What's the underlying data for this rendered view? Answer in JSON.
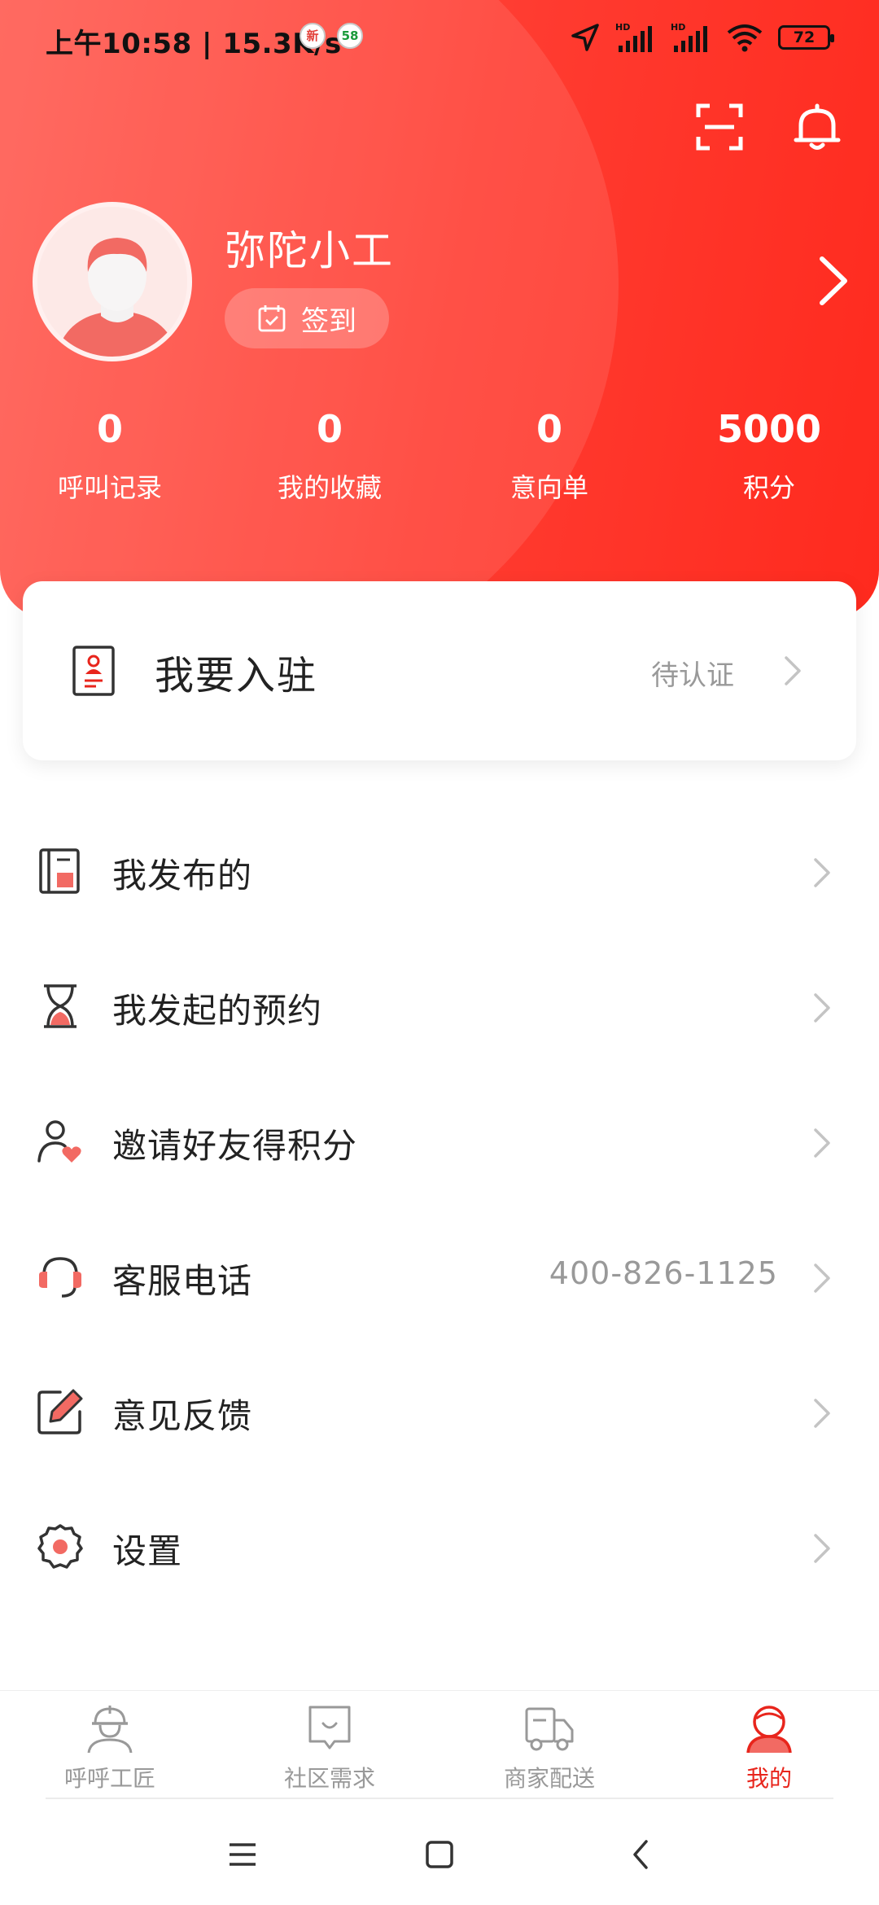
{
  "status_bar": {
    "time_speed": "上午10:58 | 15.3K/s",
    "app1": "新",
    "app2": "58",
    "battery": "72"
  },
  "profile": {
    "name": "弥陀小工",
    "checkin_label": "签到"
  },
  "stats": [
    {
      "value": "0",
      "label": "呼叫记录"
    },
    {
      "value": "0",
      "label": "我的收藏"
    },
    {
      "value": "0",
      "label": "意向单"
    },
    {
      "value": "5000",
      "label": "积分"
    }
  ],
  "join": {
    "title": "我要入驻",
    "status": "待认证"
  },
  "menu": [
    {
      "label": "我发布的",
      "value": "",
      "icon": "document-icon"
    },
    {
      "label": "我发起的预约",
      "value": "",
      "icon": "hourglass-icon"
    },
    {
      "label": "邀请好友得积分",
      "value": "",
      "icon": "invite-friend-icon"
    },
    {
      "label": "客服电话",
      "value": "400-826-1125",
      "icon": "headset-icon"
    },
    {
      "label": "意见反馈",
      "value": "",
      "icon": "edit-icon"
    },
    {
      "label": "设置",
      "value": "",
      "icon": "gear-icon"
    }
  ],
  "tabs": [
    {
      "label": "呼呼工匠",
      "active": false
    },
    {
      "label": "社区需求",
      "active": false
    },
    {
      "label": "商家配送",
      "active": false
    },
    {
      "label": "我的",
      "active": true
    }
  ],
  "colors": {
    "brand_red": "#ff3b30",
    "active_tab": "#e8251c",
    "muted_text": "#999999"
  }
}
